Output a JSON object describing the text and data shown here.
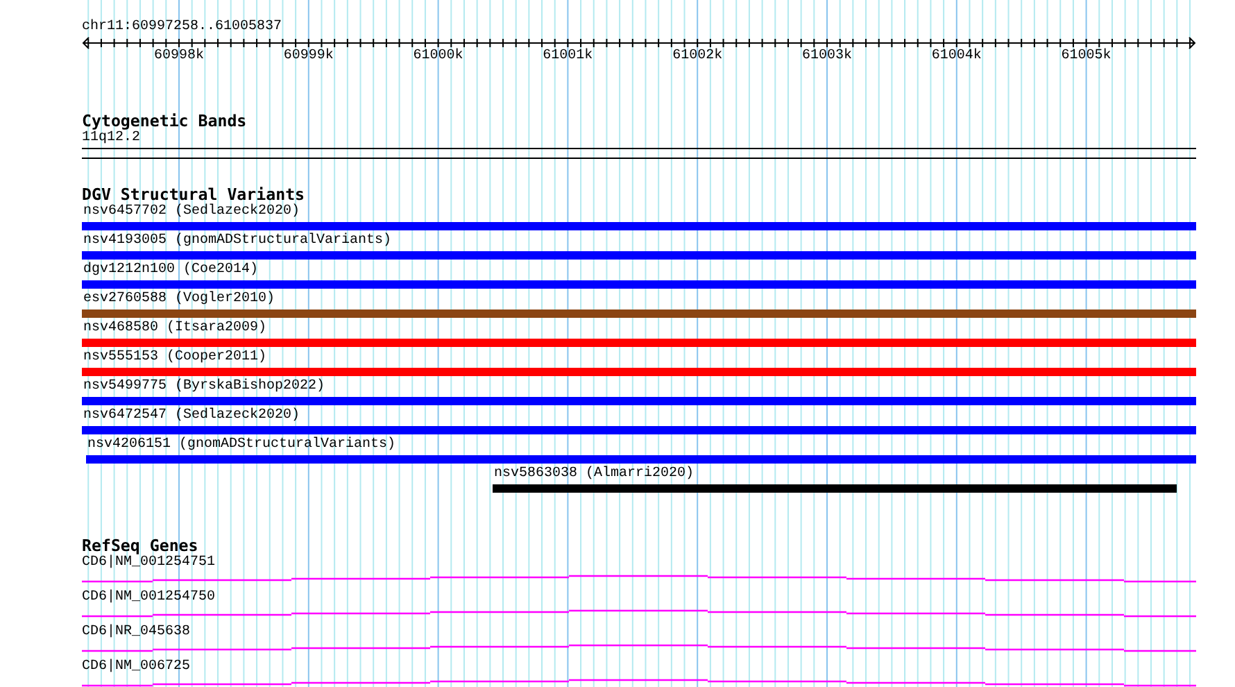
{
  "ruler": {
    "position": "chr11:60997258..61005837",
    "tick_labels": [
      "60998k",
      "60999k",
      "61000k",
      "61001k",
      "61002k",
      "61003k",
      "61004k",
      "61005k"
    ]
  },
  "tracks": [
    {
      "kind": "cytoband",
      "title": "Cytogenetic Bands",
      "band": "11q12.2"
    },
    {
      "kind": "variants",
      "title": "DGV Structural Variants",
      "items": [
        {
          "label": "nsv6457702 (Sedlazeck2020)",
          "color": "#0000ff"
        },
        {
          "label": "nsv4193005 (gnomADStructuralVariants)",
          "color": "#0000ff"
        },
        {
          "label": "dgv1212n100 (Coe2014)",
          "color": "#0000ff"
        },
        {
          "label": "esv2760588 (Vogler2010)",
          "color": "#8b4513"
        },
        {
          "label": "nsv468580 (Itsara2009)",
          "color": "#ff0000"
        },
        {
          "label": "nsv555153 (Cooper2011)",
          "color": "#ff0000"
        },
        {
          "label": "nsv5499775 (ByrskaBishop2022)",
          "color": "#0000ff"
        },
        {
          "label": "nsv6472547 (Sedlazeck2020)",
          "color": "#0000ff"
        },
        {
          "label": "nsv4206151 (gnomADStructuralVariants)",
          "color": "#0000ff"
        },
        {
          "label": "nsv5863038 (Almarri2020)",
          "color": "#000000"
        }
      ]
    },
    {
      "kind": "genes",
      "title": "RefSeq Genes",
      "items": [
        {
          "label": "CD6|NM_001254751"
        },
        {
          "label": "CD6|NM_001254750"
        },
        {
          "label": "CD6|NR_045638"
        },
        {
          "label": "CD6|NM_006725"
        }
      ]
    }
  ]
}
